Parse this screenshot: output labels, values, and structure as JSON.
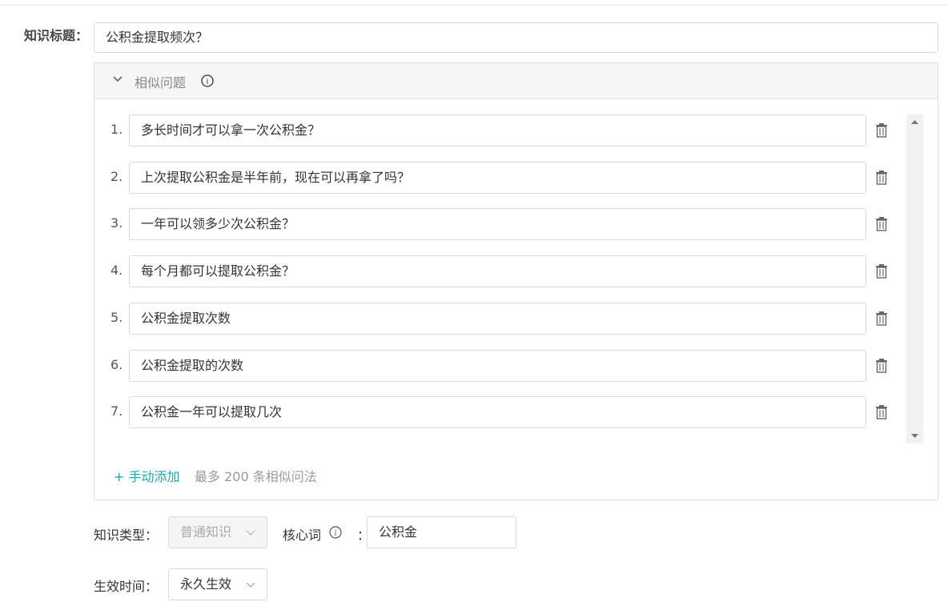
{
  "knowledge_title": {
    "label": "知识标题：",
    "value": "公积金提取频次？"
  },
  "similar_questions": {
    "title": "相似问题",
    "items": [
      {
        "num": "1.",
        "text": "多长时间才可以拿一次公积金？"
      },
      {
        "num": "2.",
        "text": "上次提取公积金是半年前，现在可以再拿了吗？"
      },
      {
        "num": "3.",
        "text": "一年可以领多少次公积金？"
      },
      {
        "num": "4.",
        "text": "每个月都可以提取公积金？"
      },
      {
        "num": "5.",
        "text": "公积金提取次数"
      },
      {
        "num": "6.",
        "text": "公积金提取的次数"
      },
      {
        "num": "7.",
        "text": "公积金一年可以提取几次"
      }
    ],
    "add_label": "+ 手动添加",
    "add_hint": "最多 200 条相似问法"
  },
  "knowledge_type": {
    "label": "知识类型：",
    "value": "普通知识"
  },
  "core_word": {
    "label": "核心词",
    "colon": "：",
    "value": "公积金"
  },
  "effective_time": {
    "label": "生效时间：",
    "value": "永久生效"
  },
  "colors": {
    "accent": "#1aaab2",
    "border": "#d9d9d9",
    "header_bg": "#f6f6f6"
  }
}
